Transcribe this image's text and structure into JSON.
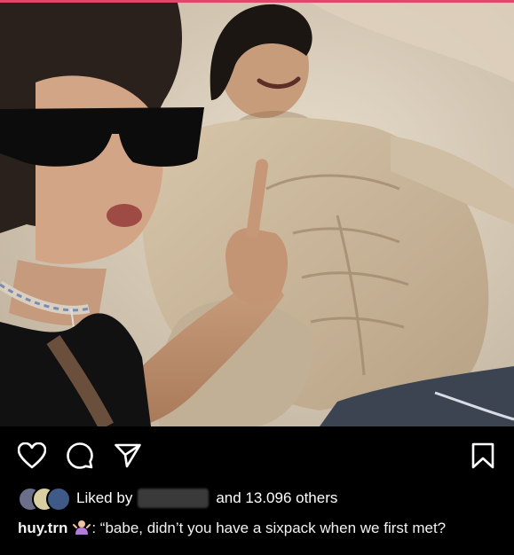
{
  "post": {
    "photo_alt": "",
    "liked_by_prefix": "Liked by",
    "liked_by_suffix": "and 13.096 others",
    "caption_user": "huy.trn",
    "caption_text": ": “babe, didn’t you have a sixpack when we first met?"
  },
  "icons": {
    "like": "heart-icon",
    "comment": "comment-icon",
    "share": "send-icon",
    "save": "bookmark-icon",
    "caption_emoji": "person-shrugging-emoji-icon"
  },
  "colors": {
    "background": "#000000",
    "text": "#ffffff",
    "accent_top_bar": "#e0486b"
  }
}
